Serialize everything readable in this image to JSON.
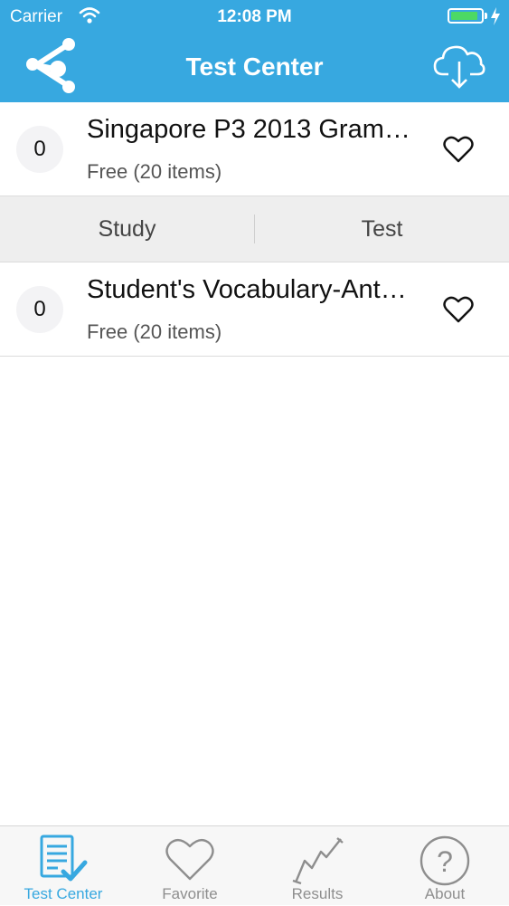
{
  "status_bar": {
    "carrier": "Carrier",
    "time": "12:08 PM"
  },
  "header": {
    "title": "Test Center",
    "share_icon": "share-icon",
    "download_icon": "cloud-download-icon"
  },
  "tests": [
    {
      "count": "0",
      "title": "Singapore P3 2013 Gram…",
      "subtitle": "Free (20 items)",
      "favorite_icon": "heart-outline-icon"
    },
    {
      "count": "0",
      "title": "Student's Vocabulary-Ant…",
      "subtitle": "Free (20 items)",
      "favorite_icon": "heart-outline-icon"
    }
  ],
  "segment": {
    "study_label": "Study",
    "test_label": "Test"
  },
  "tab_bar": {
    "active_color": "#37a8e0",
    "items": [
      {
        "label": "Test Center",
        "icon": "checklist-icon",
        "active": true
      },
      {
        "label": "Favorite",
        "icon": "heart-icon",
        "active": false
      },
      {
        "label": "Results",
        "icon": "results-graph-icon",
        "active": false
      },
      {
        "label": "About",
        "icon": "question-icon",
        "active": false
      }
    ]
  },
  "colors": {
    "brand": "#37a8e0",
    "battery": "#4cd964"
  }
}
